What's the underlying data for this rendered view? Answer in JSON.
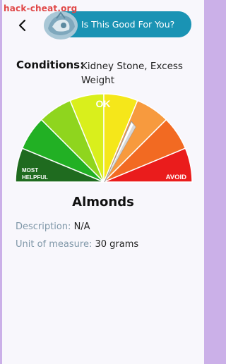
{
  "watermark": "hack-cheat.org",
  "header": {
    "title": "Is This Good For You?"
  },
  "conditions": {
    "label": "Conditions:",
    "value": "Kidney Stone, Excess Weight"
  },
  "gauge": {
    "label_ok": "OK",
    "label_most": "MOST",
    "label_helpful": "HELPFUL",
    "label_avoid": "AVOID",
    "segment_colors": [
      "#1f6b1f",
      "#22b024",
      "#8fd51e",
      "#d9ef1c",
      "#f5e71a",
      "#f79a3e",
      "#f26a22",
      "#ea1c1c"
    ]
  },
  "food": {
    "name": "Almonds",
    "description_label": "Description:",
    "description_value": "N/A",
    "unit_label": "Unit of measure:",
    "unit_value": "30 grams"
  }
}
